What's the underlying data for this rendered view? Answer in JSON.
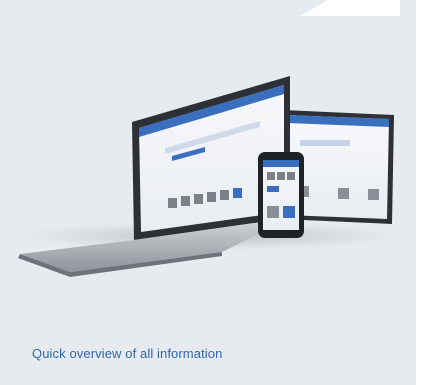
{
  "card": {
    "caption": "Quick overview of all information",
    "illustration_alt": "devices-showing-dashboard",
    "accent_color": "#2f66b3",
    "background_color": "#e7ebef"
  }
}
